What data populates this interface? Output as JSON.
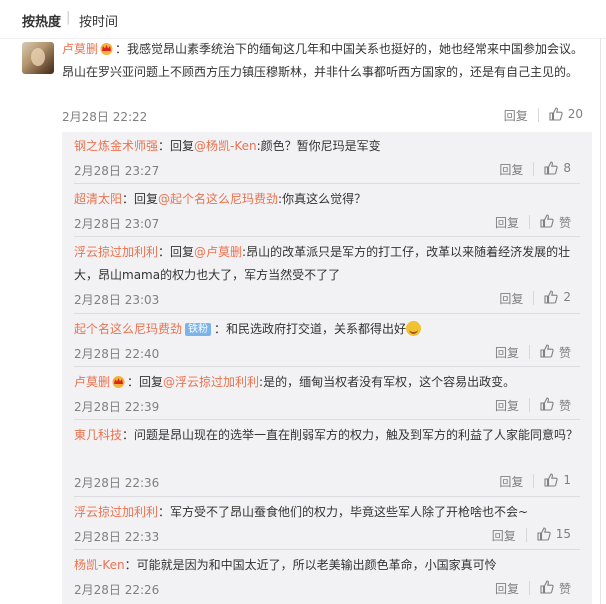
{
  "sort": {
    "hot": "按热度",
    "separator": "|",
    "time": "按时间"
  },
  "top_comment": {
    "user": "卢莫删",
    "text": "：我感觉昂山素季统治下的缅甸这几年和中国关系也挺好的，她也经常来中国参加会议。昂山在罗兴亚问题上不顾西方压力镇压穆斯林，并非什么事都听西方国家的，还是有自己主见的。",
    "time": "2月28日 22:22",
    "reply_label": "回复",
    "likes": "20"
  },
  "replies": [
    {
      "user": "钢之炼金术师强",
      "pre": "：回复",
      "mention": "@杨凯-Ken",
      "text": ":颜色？暂你尼玛是军变",
      "time": "2月28日 23:27",
      "reply_label": "回复",
      "likes": "8"
    },
    {
      "user": "超清太阳",
      "pre": "：回复",
      "mention": "@起个名这么尼玛费劲",
      "text": ":你真这么觉得？",
      "time": "2月28日 23:07",
      "reply_label": "回复",
      "likes": "赞"
    },
    {
      "user": "浮云掠过加利利",
      "pre": "：回复",
      "mention": "@卢莫删",
      "text": ":昂山的改革派只是军方的打工仔，改革以来随着经济发展的壮大，昂山mama的权力也大了，军方当然受不了了",
      "time": "2月28日 23:03",
      "reply_label": "回复",
      "likes": "2"
    },
    {
      "user": "起个名这么尼玛费劲",
      "badge": "铁粉",
      "pre": "",
      "mention": "",
      "text": "：和民选政府打交道，关系都得出好",
      "time": "2月28日 22:40",
      "reply_label": "回复",
      "likes": "赞"
    },
    {
      "user": "卢莫删",
      "pre": "：回复",
      "mention": "@浮云掠过加利利",
      "text": ":是的，缅甸当权者没有军权，这个容易出政变。",
      "time": "2月28日 22:39",
      "reply_label": "回复",
      "likes": "赞"
    },
    {
      "user": "東几科技",
      "pre": "",
      "mention": "",
      "text": "：问题是昂山现在的选举一直在削弱军方的权力，触及到军方的利益了人家能同意吗？",
      "time": "2月28日 22:36",
      "reply_label": "回复",
      "likes": "1"
    },
    {
      "user": "浮云掠过加利利",
      "pre": "",
      "mention": "",
      "text": "：军方受不了昂山蚕食他们的权力，毕竟这些军人除了开枪啥也不会~",
      "time": "2月28日 22:33",
      "reply_label": "回复",
      "likes": "15"
    },
    {
      "user": "杨凯-Ken",
      "pre": "",
      "mention": "",
      "text": "：可能就是因为和中国太近了，所以老美输出颜色革命，小国家真可怜",
      "time": "2月28日 22:26",
      "reply_label": "回复",
      "likes": "赞"
    }
  ],
  "colors": {
    "username": "#eb7350",
    "mention": "#eb7350",
    "timestamp": "#808080",
    "reply_bg": "#f2f2f5"
  },
  "icons": {
    "thumb": "thumb-up-icon",
    "crown": "crown-icon",
    "emoji": "smile-emoji-icon"
  }
}
